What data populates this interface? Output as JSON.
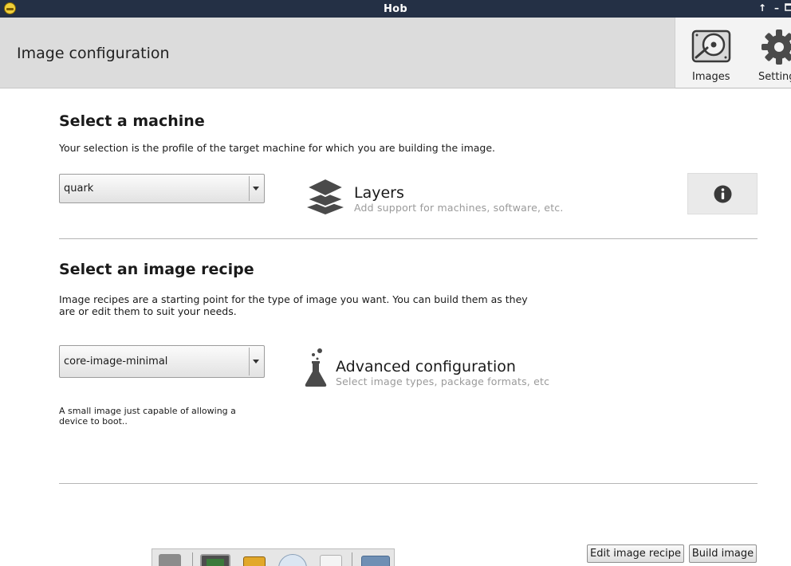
{
  "window": {
    "title": "Hob"
  },
  "header": {
    "title": "Image configuration"
  },
  "toolbar": {
    "images_label": "Images",
    "settings_label": "Settings"
  },
  "machine": {
    "heading": "Select a machine",
    "description": "Your selection is the profile of the target machine for which you are building the image.",
    "selected": "quark"
  },
  "layers": {
    "title": "Layers",
    "subtitle": "Add support for machines, software, etc."
  },
  "recipe": {
    "heading": "Select an image recipe",
    "description": "Image recipes are a starting point for the type of image you want. You can build them as they are or edit them to suit your needs.",
    "selected": "core-image-minimal",
    "selected_description": "A small image just capable of allowing a device to boot.."
  },
  "advanced": {
    "title": "Advanced configuration",
    "subtitle": "Select image types, package formats, etc"
  },
  "buttons": {
    "edit_recipe": "Edit image recipe",
    "build_image": "Build image"
  },
  "icons": [
    "app-icon",
    "hard-disk-icon",
    "gear-icon",
    "layers-icon",
    "flask-icon",
    "info-icon",
    "chevron-down-icon"
  ],
  "colors": {
    "titlebar": "#243045",
    "header": "#dcdcdc",
    "subtitle": "#9a9a9a"
  }
}
